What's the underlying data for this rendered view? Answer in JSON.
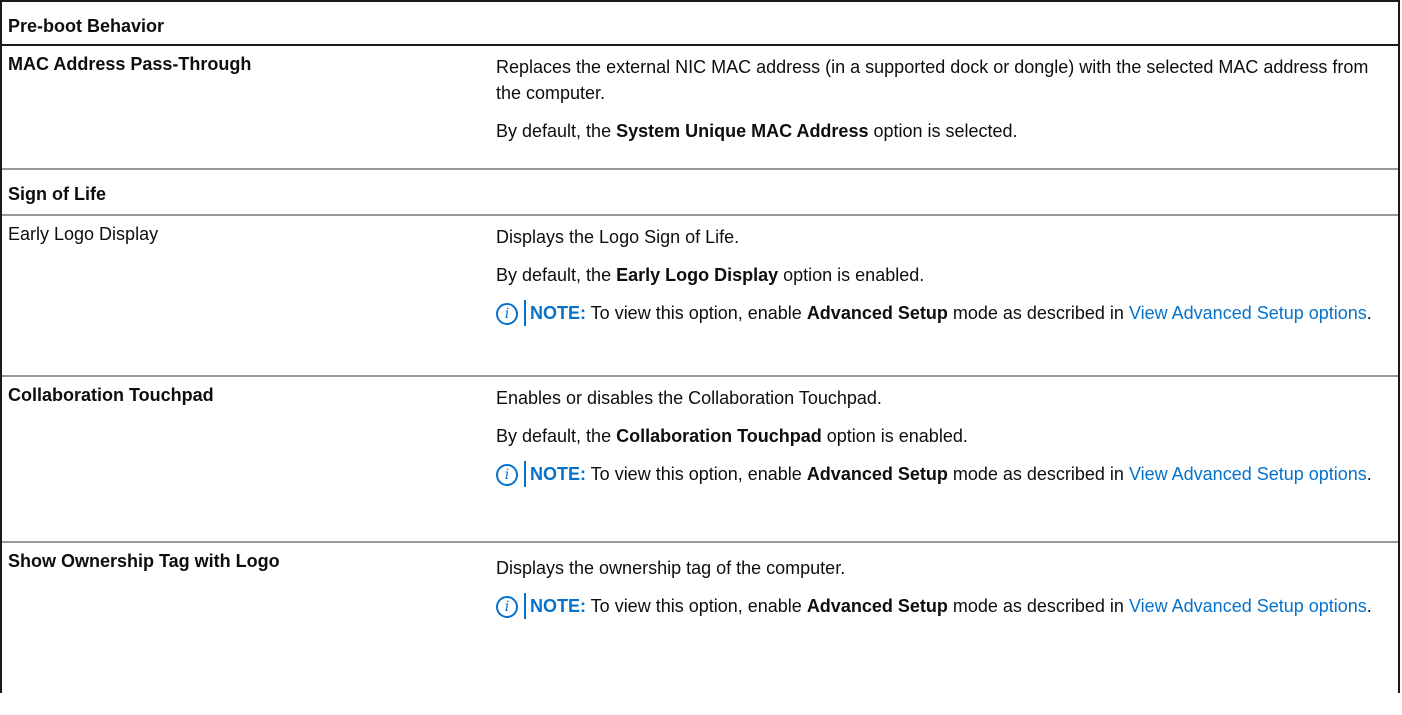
{
  "sections": {
    "preboot": "Pre-boot Behavior",
    "signoflife": "Sign of Life"
  },
  "rows": {
    "mac": {
      "name": "MAC Address Pass-Through",
      "desc": "Replaces the external NIC MAC address (in a supported dock or dongle) with the selected MAC address from the computer.",
      "default_pre": "By default, the ",
      "default_bold": "System Unique MAC Address",
      "default_post": " option is selected."
    },
    "early": {
      "name": "Early Logo Display",
      "desc": "Displays the Logo Sign of Life.",
      "default_pre": "By default, the ",
      "default_bold": "Early Logo Display",
      "default_post": " option is enabled."
    },
    "collab": {
      "name": "Collaboration Touchpad",
      "desc": "Enables or disables the Collaboration Touchpad.",
      "default_pre": "By default, the ",
      "default_bold": "Collaboration Touchpad",
      "default_post": " option is enabled."
    },
    "owner": {
      "name": "Show Ownership Tag with Logo",
      "desc": "Displays the ownership tag of the computer."
    }
  },
  "note": {
    "icon": "info-icon",
    "icon_glyph": "i",
    "label": "NOTE:",
    "pre": " To view this option, enable ",
    "bold": "Advanced Setup",
    "post": " mode as described in ",
    "link": "View Advanced Setup options",
    "end": "."
  },
  "colors": {
    "accent": "#0672cb"
  }
}
